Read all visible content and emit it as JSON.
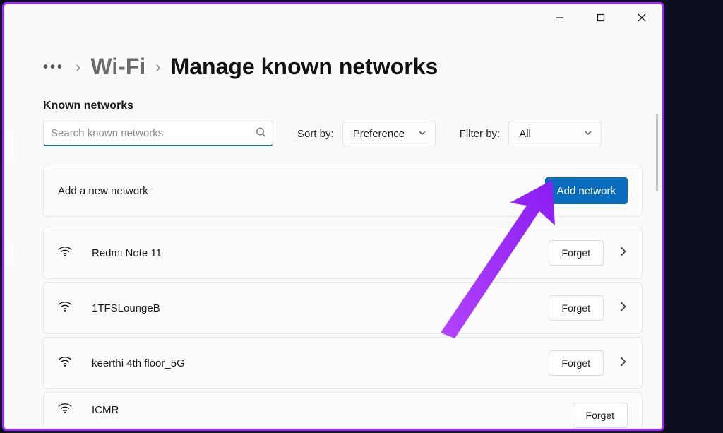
{
  "breadcrumb": {
    "parent": "Wi-Fi",
    "current": "Manage known networks"
  },
  "section_title": "Known networks",
  "search": {
    "placeholder": "Search known networks",
    "value": ""
  },
  "sort": {
    "label": "Sort by:",
    "value": "Preference"
  },
  "filter": {
    "label": "Filter by:",
    "value": "All"
  },
  "add_card": {
    "label": "Add a new network",
    "button": "Add network"
  },
  "forget_label": "Forget",
  "networks": [
    {
      "name": "Redmi Note 11"
    },
    {
      "name": "1TFSLoungeB"
    },
    {
      "name": "keerthi 4th floor_5G"
    },
    {
      "name": "ICMR"
    }
  ]
}
